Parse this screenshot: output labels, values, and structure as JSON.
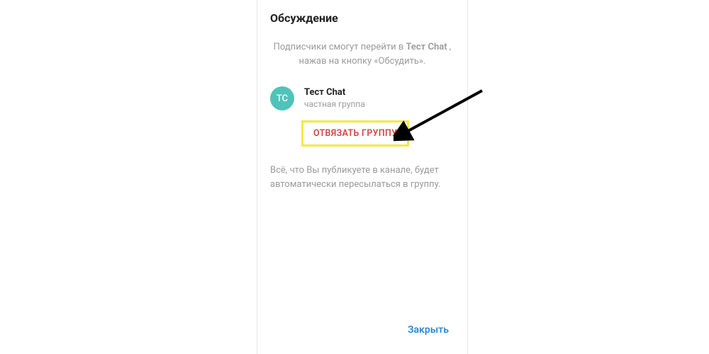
{
  "title": "Обсуждение",
  "description_prefix": "Подписчики смогут перейти в ",
  "description_chat_name": "Тест Chat",
  "description_suffix": " , нажав на кнопку «Обсудить».",
  "group": {
    "avatar_initials": "ТС",
    "name": "Тест Chat",
    "type": "частная группа"
  },
  "unlink_label": "ОТВЯЗАТЬ ГРУППУ",
  "footer_text": "Всё, что Вы публикуете в канале, будет автоматически пересылаться в группу.",
  "close_label": "Закрыть"
}
